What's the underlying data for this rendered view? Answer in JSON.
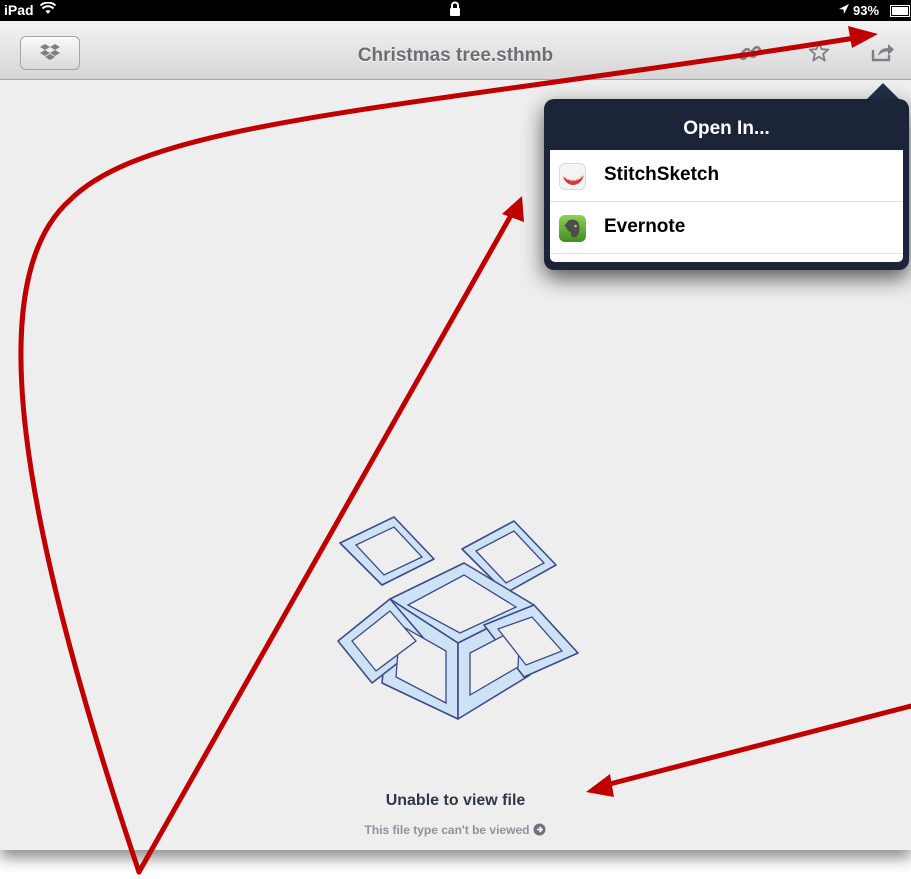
{
  "status_bar": {
    "carrier": "iPad",
    "battery": "93%",
    "icons": {
      "wifi": "wifi-icon",
      "lock": "lock-icon",
      "location": "location-arrow-icon",
      "battery": "battery-icon"
    }
  },
  "toolbar": {
    "title": "Christmas tree.sthmb",
    "icons": [
      "dropbox-icon",
      "link-icon",
      "star-icon",
      "share-icon"
    ]
  },
  "open_in_popover": {
    "title": "Open In...",
    "items": [
      {
        "label": "StitchSketch",
        "icon": "stitchsketch-app-icon"
      },
      {
        "label": "Evernote",
        "icon": "evernote-app-icon"
      }
    ]
  },
  "empty_state": {
    "title": "Unable to view file",
    "subtitle": "This file type can't be viewed",
    "icon": "open-box-illustration"
  },
  "colors": {
    "annotation_arrow": "#c00000",
    "popover_bg": "#1c2538",
    "screen_bg": "#eeeeee",
    "title_text": "#6b6f74"
  }
}
